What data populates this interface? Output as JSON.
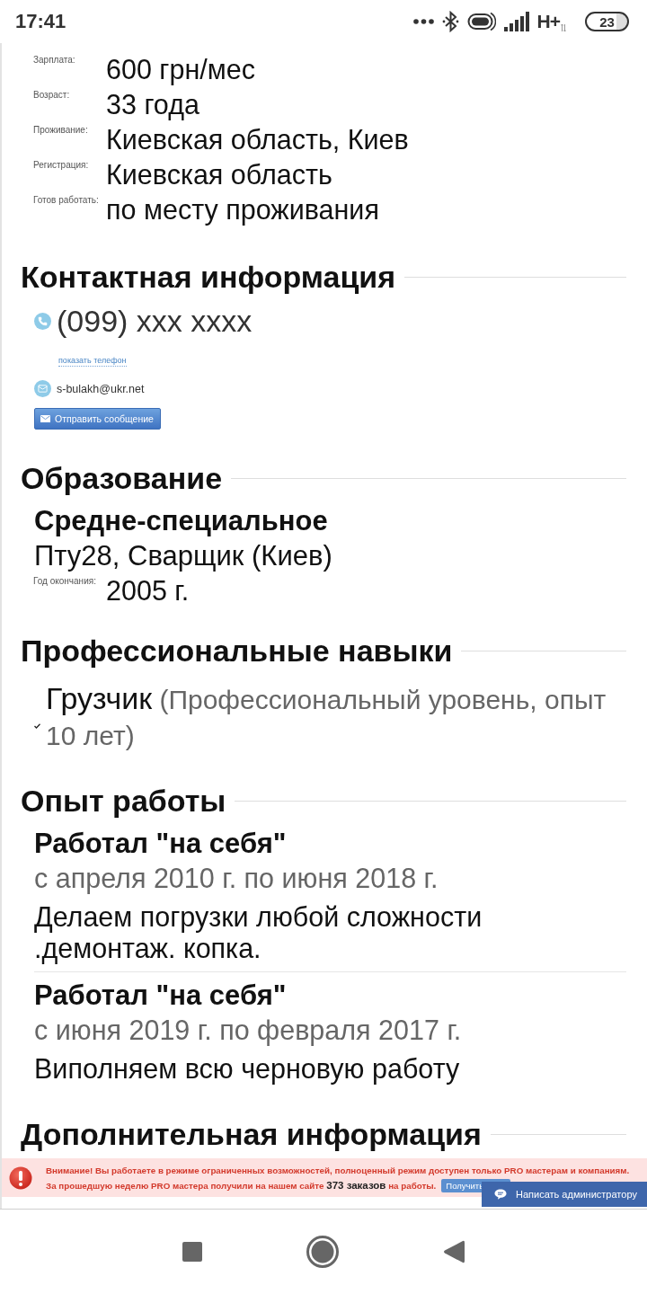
{
  "status_bar": {
    "time": "17:41",
    "network": "H+",
    "battery": "23"
  },
  "details": [
    {
      "label": "Зарплата:",
      "value": "600 грн/мес"
    },
    {
      "label": "Возраст:",
      "value": "33 года"
    },
    {
      "label": "Проживание:",
      "value": "Киевская область, Киев"
    },
    {
      "label": "Регистрация:",
      "value": "Киевская область"
    },
    {
      "label": "Готов работать:",
      "value": "по месту проживания"
    }
  ],
  "sections": [
    {
      "kind": "contacts",
      "title": "Контактная информация",
      "phone": "(099) xxx xxxx",
      "show_phone_link": "показать телефон",
      "email": "s-bulakh@ukr.net",
      "message_button": "Отправить сообщение"
    },
    {
      "kind": "education",
      "title": "Образование",
      "degree": "Средне-специальное",
      "school": "Пту28, Сварщик (Киев)",
      "details": [
        {
          "label": "Год окончания:",
          "value": "2005 г."
        }
      ]
    },
    {
      "kind": "skills",
      "title": "Профессиональные навыки",
      "skills": [
        {
          "name": "Грузчик",
          "note": "(Профессиональный уровень, опыт 10 лет)"
        }
      ]
    },
    {
      "kind": "experience",
      "title": "Опыт работы",
      "jobs": [
        {
          "title": "Работал \"на себя\"",
          "period": "с апреля 2010 г. по июня 2018 г.",
          "description": "Делаем погрузки любой сложности .демонтаж. копка."
        },
        {
          "title": "Работал \"на себя\"",
          "period": "с июня 2019 г. по февраля 2017 г.",
          "description": "Виполняем всю черновую работу"
        }
      ]
    },
    {
      "kind": "additional",
      "title": "Дополнительная информация"
    }
  ],
  "notice": {
    "lines": [
      "Внимание! Вы работаете в режиме ограниченных возможностей, полноценный режим доступен только PRO мастерам и компаниям.",
      "За прошедшую неделю PRO мастера получили на нашем сайте **373 заказов** на работы."
    ],
    "button": "Получить"
  },
  "admin_button": "Написать администратору"
}
